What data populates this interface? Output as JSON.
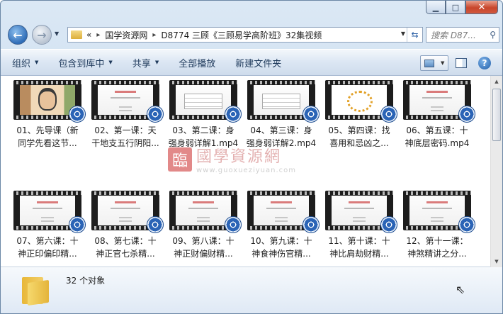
{
  "window": {
    "controls": {
      "minimize": "▁",
      "maximize": "□",
      "close": "✕"
    }
  },
  "nav": {
    "back_icon": "left-arrow-icon",
    "forward_icon": "right-arrow-icon"
  },
  "address": {
    "prefix": "«",
    "crumbs": [
      "国学资源网",
      "D8774 三顾《三顾易学高阶班》32集视频"
    ],
    "separator": "▸"
  },
  "search": {
    "placeholder": "搜索 D87..."
  },
  "toolbar": {
    "organize": "组织",
    "include_library": "包含到库中",
    "share": "共享",
    "play_all": "全部播放",
    "new_folder": "新建文件夹"
  },
  "files": [
    {
      "line1": "01、先导课（新",
      "line2": "同学先看这节...",
      "thumb": "photo"
    },
    {
      "line1": "02、第一课：天",
      "line2": "干地支五行阴阳...",
      "thumb": "slide"
    },
    {
      "line1": "03、第二课：身",
      "line2": "强身弱详解1.mp4",
      "thumb": "table"
    },
    {
      "line1": "04、第三课：身",
      "line2": "强身弱详解2.mp4",
      "thumb": "table"
    },
    {
      "line1": "05、第四课：找",
      "line2": "喜用和忌凶之...",
      "thumb": "chart"
    },
    {
      "line1": "06、第五课：十",
      "line2": "神底层密码.mp4",
      "thumb": "slide"
    },
    {
      "line1": "07、第六课：十",
      "line2": "神正印偏印精...",
      "thumb": "slide"
    },
    {
      "line1": "08、第七课：十",
      "line2": "神正官七杀精...",
      "thumb": "slide"
    },
    {
      "line1": "09、第八课：十",
      "line2": "神正财偏财精...",
      "thumb": "slide"
    },
    {
      "line1": "10、第九课：十",
      "line2": "神食神伤官精...",
      "thumb": "slide"
    },
    {
      "line1": "11、第十课：十",
      "line2": "神比肩劫财精...",
      "thumb": "slide"
    },
    {
      "line1": "12、第十一课：",
      "line2": "神煞精讲之分...",
      "thumb": "slide"
    }
  ],
  "watermark": {
    "seal": "臨",
    "cn": "國學資源網",
    "url": "www.guoxueziyuan.com"
  },
  "status": {
    "count": "32 个对象"
  }
}
